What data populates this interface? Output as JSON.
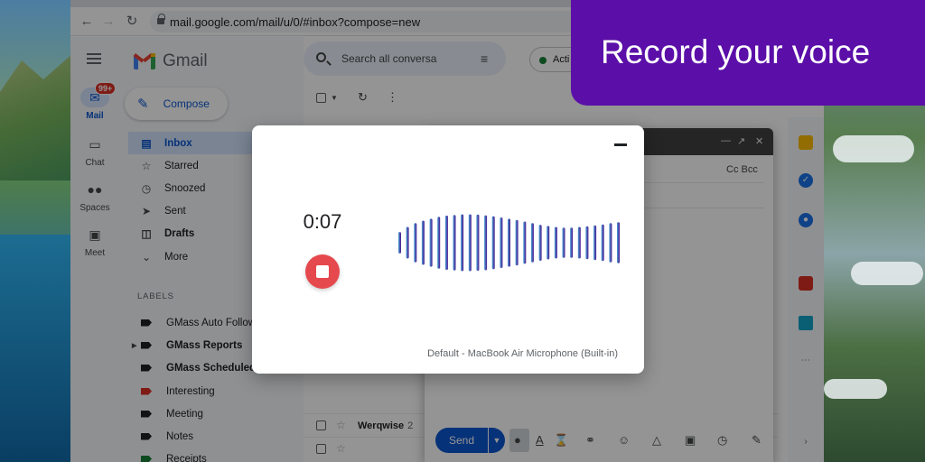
{
  "browser": {
    "url": "mail.google.com/mail/u/0/#inbox?compose=new"
  },
  "gmail": {
    "product_name": "Gmail",
    "rail": [
      {
        "label": "Mail",
        "badge": "99+"
      },
      {
        "label": "Chat"
      },
      {
        "label": "Spaces"
      },
      {
        "label": "Meet"
      }
    ],
    "compose_label": "Compose",
    "folders": [
      "Inbox",
      "Starred",
      "Snoozed",
      "Sent",
      "Drafts",
      "More"
    ],
    "labels_heading": "LABELS",
    "labels": [
      {
        "name": "GMass Auto Follow",
        "color": "#202124"
      },
      {
        "name": "GMass Reports",
        "color": "#202124"
      },
      {
        "name": "GMass Scheduled",
        "color": "#202124"
      },
      {
        "name": "Interesting",
        "color": "#d93025"
      },
      {
        "name": "Meeting",
        "color": "#202124"
      },
      {
        "name": "Notes",
        "color": "#202124"
      },
      {
        "name": "Receipts",
        "color": "#188038"
      }
    ],
    "search_placeholder": "Search all conversa",
    "status_chip": "Acti",
    "visible_row": {
      "from": "Werqwise",
      "count": "2"
    },
    "compose_window": {
      "cc_bcc": "Cc Bcc",
      "send_label": "Send"
    }
  },
  "recorder": {
    "elapsed": "0:07",
    "device": "Default - MacBook Air Microphone (Built-in)",
    "wave_levels": [
      0.34,
      0.5,
      0.62,
      0.7,
      0.76,
      0.82,
      0.86,
      0.88,
      0.9,
      0.9,
      0.89,
      0.87,
      0.84,
      0.8,
      0.76,
      0.72,
      0.67,
      0.62,
      0.57,
      0.53,
      0.5,
      0.48,
      0.48,
      0.5,
      0.52,
      0.55,
      0.58,
      0.62,
      0.65
    ],
    "wave_colors": {
      "start": "#4ba3d9",
      "end": "#4a148c"
    }
  },
  "banner": {
    "text": "Record your voice",
    "color": "#5b0fa8"
  }
}
